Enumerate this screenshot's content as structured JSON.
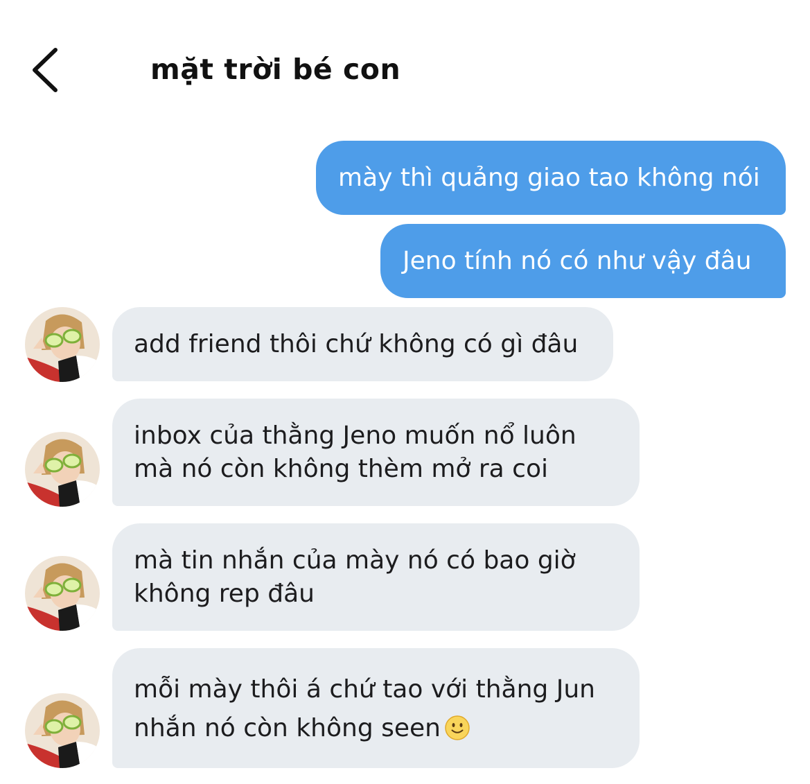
{
  "header": {
    "title": "mặt trời bé con",
    "back_icon": "chevron-left-icon"
  },
  "colors": {
    "sent_bubble": "#4e9de9",
    "received_bubble": "#e8ecf0",
    "background": "#ffffff"
  },
  "messages": [
    {
      "direction": "sent",
      "lines": [
        "mày thì quảng giao tao không nói"
      ]
    },
    {
      "direction": "sent",
      "lines": [
        "Jeno tính nó có như vậy đâu"
      ]
    },
    {
      "direction": "received",
      "lines": [
        "add friend thôi chứ không có gì đâu"
      ]
    },
    {
      "direction": "received",
      "lines": [
        "inbox của thằng Jeno muốn nổ luôn",
        "mà nó còn không thèm mở ra coi"
      ]
    },
    {
      "direction": "received",
      "lines": [
        "mà tin nhắn của mày nó có bao giờ",
        "không rep đâu"
      ]
    },
    {
      "direction": "received",
      "lines": [
        "mỗi mày thôi á chứ tao với thằng Jun",
        "nhắn nó còn không seen"
      ],
      "emoji": "slightly-smiling-face-icon"
    }
  ]
}
